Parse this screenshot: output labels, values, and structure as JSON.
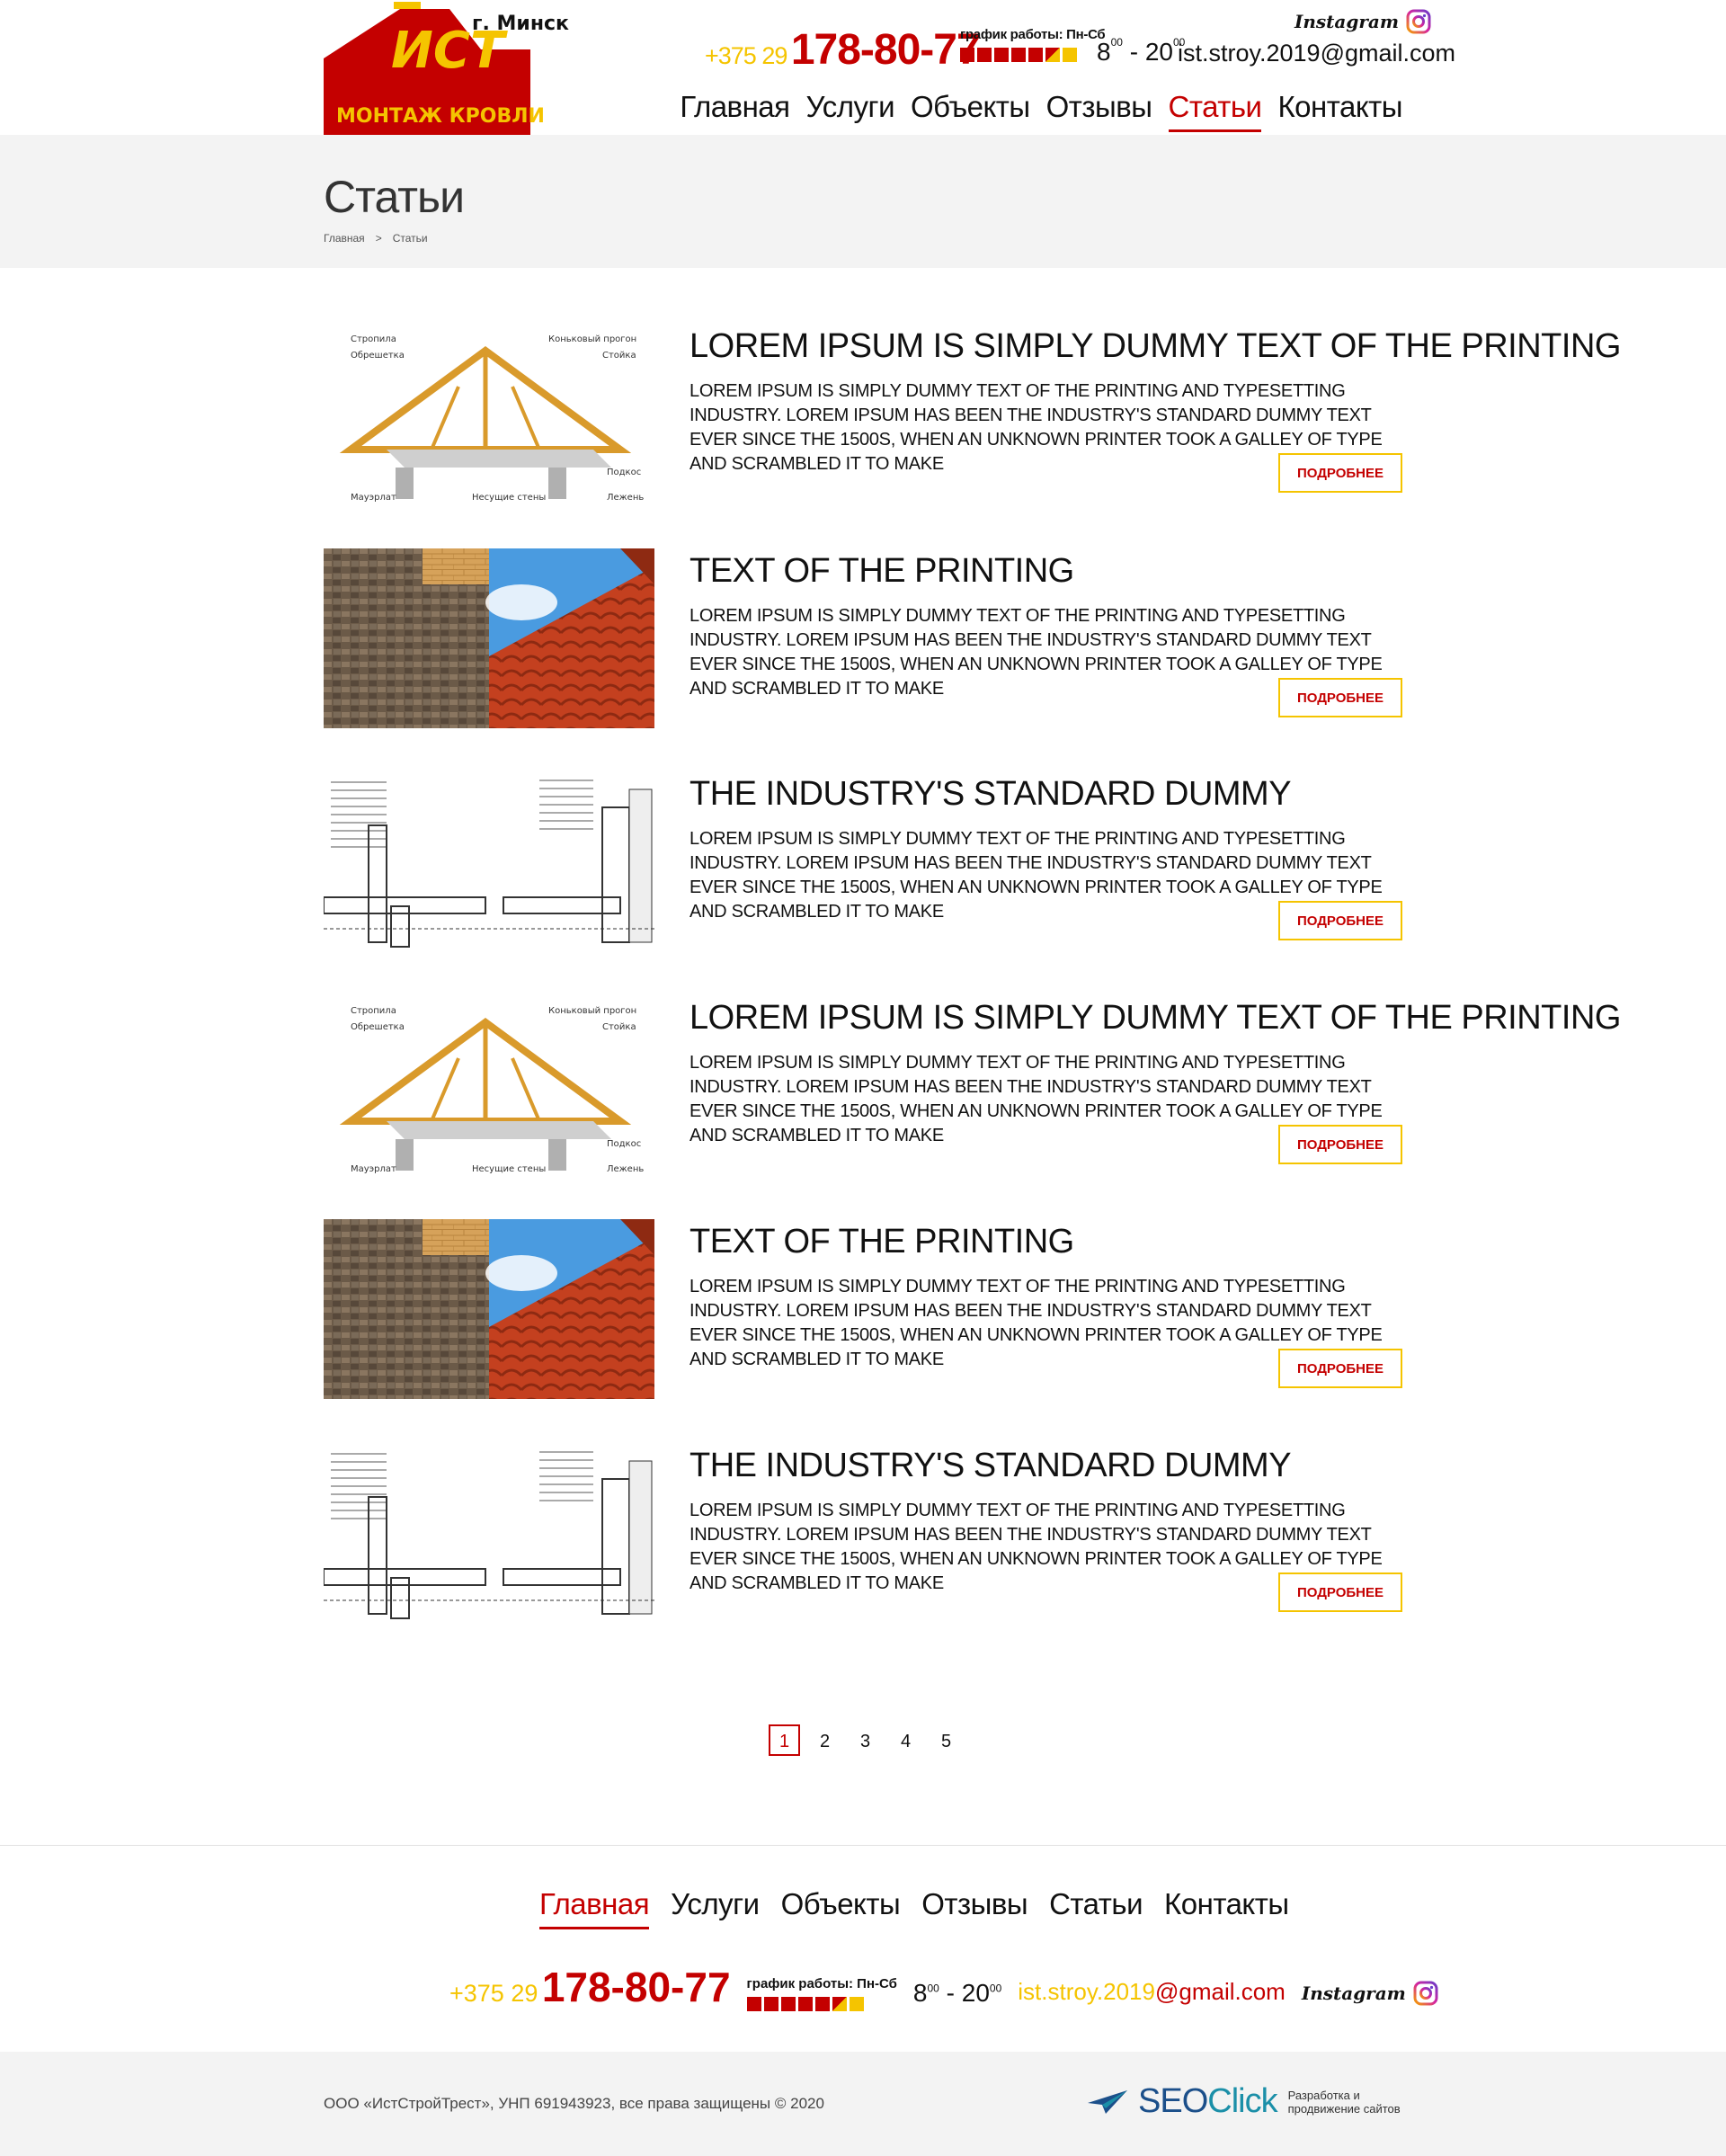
{
  "header": {
    "city": "г. Минск",
    "logo_text": "ИСТ МОНТАЖ КРОВЛИ",
    "phone_prefix": "+375 29",
    "phone_number": "178-80-77",
    "schedule_label": "график работы: Пн-Сб",
    "hours_from": "8",
    "hours_from_sup": "00",
    "hours_sep": " - ",
    "hours_to": "20",
    "hours_to_sup": "00",
    "email": "ist.stroy.2019@gmail.com",
    "instagram": "Instagram",
    "nav": [
      "Главная",
      "Услуги",
      "Объекты",
      "Отзывы",
      "Статьи",
      "Контакты"
    ],
    "nav_active": "Статьи"
  },
  "page": {
    "title": "Статьи",
    "breadcrumbs": [
      "Главная",
      "Статьи"
    ],
    "breadcrumb_sep": ">"
  },
  "articles": [
    {
      "title": "Lorem Ipsum is simply dummy text of the printing",
      "text": "Lorem Ipsum is simply dummy text of the printing and typesetting industry. Lorem Ipsum has been the industry's standard dummy text ever since the 1500s, when an unknown printer took a galley of type and scrambled it to make",
      "button": "Подробнее",
      "image": "roof-truss-diagram"
    },
    {
      "title": "text of the printing",
      "text": "Lorem Ipsum is simply dummy text of the printing and typesetting industry. Lorem Ipsum has been the industry's standard dummy text ever since the 1500s, when an unknown printer took a galley of type and scrambled it to make",
      "button": "Подробнее",
      "image": "roof-tiles-photo"
    },
    {
      "title": "the industry's standard dummy",
      "text": "Lorem Ipsum is simply dummy text of the printing and typesetting industry. Lorem Ipsum has been the industry's standard dummy text ever since the 1500s, when an unknown printer took a galley of type and scrambled it to make",
      "button": "Подробнее",
      "image": "roof-section-drawing"
    },
    {
      "title": "Lorem Ipsum is simply dummy text of the printing",
      "text": "Lorem Ipsum is simply dummy text of the printing and typesetting industry. Lorem Ipsum has been the industry's standard dummy text ever since the 1500s, when an unknown printer took a galley of type and scrambled it to make",
      "button": "Подробнее",
      "image": "roof-truss-diagram"
    },
    {
      "title": "text of the printing",
      "text": "Lorem Ipsum is simply dummy text of the printing and typesetting industry. Lorem Ipsum has been the industry's standard dummy text ever since the 1500s, when an unknown printer took a galley of type and scrambled it to make",
      "button": "Подробнее",
      "image": "roof-tiles-photo"
    },
    {
      "title": "the industry's standard dummy",
      "text": "Lorem Ipsum is simply dummy text of the printing and typesetting industry. Lorem Ipsum has been the industry's standard dummy text ever since the 1500s, when an unknown printer took a galley of type and scrambled it to make",
      "button": "Подробнее",
      "image": "roof-section-drawing"
    }
  ],
  "truss_labels": {
    "rafters": "Стропила",
    "battens": "Обрешетка",
    "ridge": "Коньковый прогон",
    "post": "Стойка",
    "strut": "Подкос",
    "mauerlat": "Мауэрлат",
    "walls": "Несущие стены",
    "sill": "Лежень"
  },
  "pagination": {
    "pages": [
      "1",
      "2",
      "3",
      "4",
      "5"
    ],
    "active": "1"
  },
  "footer": {
    "nav": [
      "Главная",
      "Услуги",
      "Объекты",
      "Отзывы",
      "Статьи",
      "Контакты"
    ],
    "nav_active": "Главная",
    "phone_prefix": "+375 29",
    "phone_number": "178-80-77",
    "schedule_label": "график работы: Пн-Сб",
    "hours_from": "8",
    "hours_from_sup": "00",
    "hours_sep": " - ",
    "hours_to": "20",
    "hours_to_sup": "00",
    "email_user": "ist.stroy.2019",
    "email_domain": "@gmail.com",
    "instagram": "Instagram",
    "copyright": "ООО «ИстСтройТрест», УНП 691943923, все права защищены © 2020",
    "dev_brand_a": "SEO",
    "dev_brand_b": "Click",
    "dev_desc_1": "Разработка и",
    "dev_desc_2": "продвижение сайтов"
  },
  "colors": {
    "accent_red": "#c40000",
    "accent_yellow": "#f5c400",
    "band_gray": "#f3f3f3"
  }
}
